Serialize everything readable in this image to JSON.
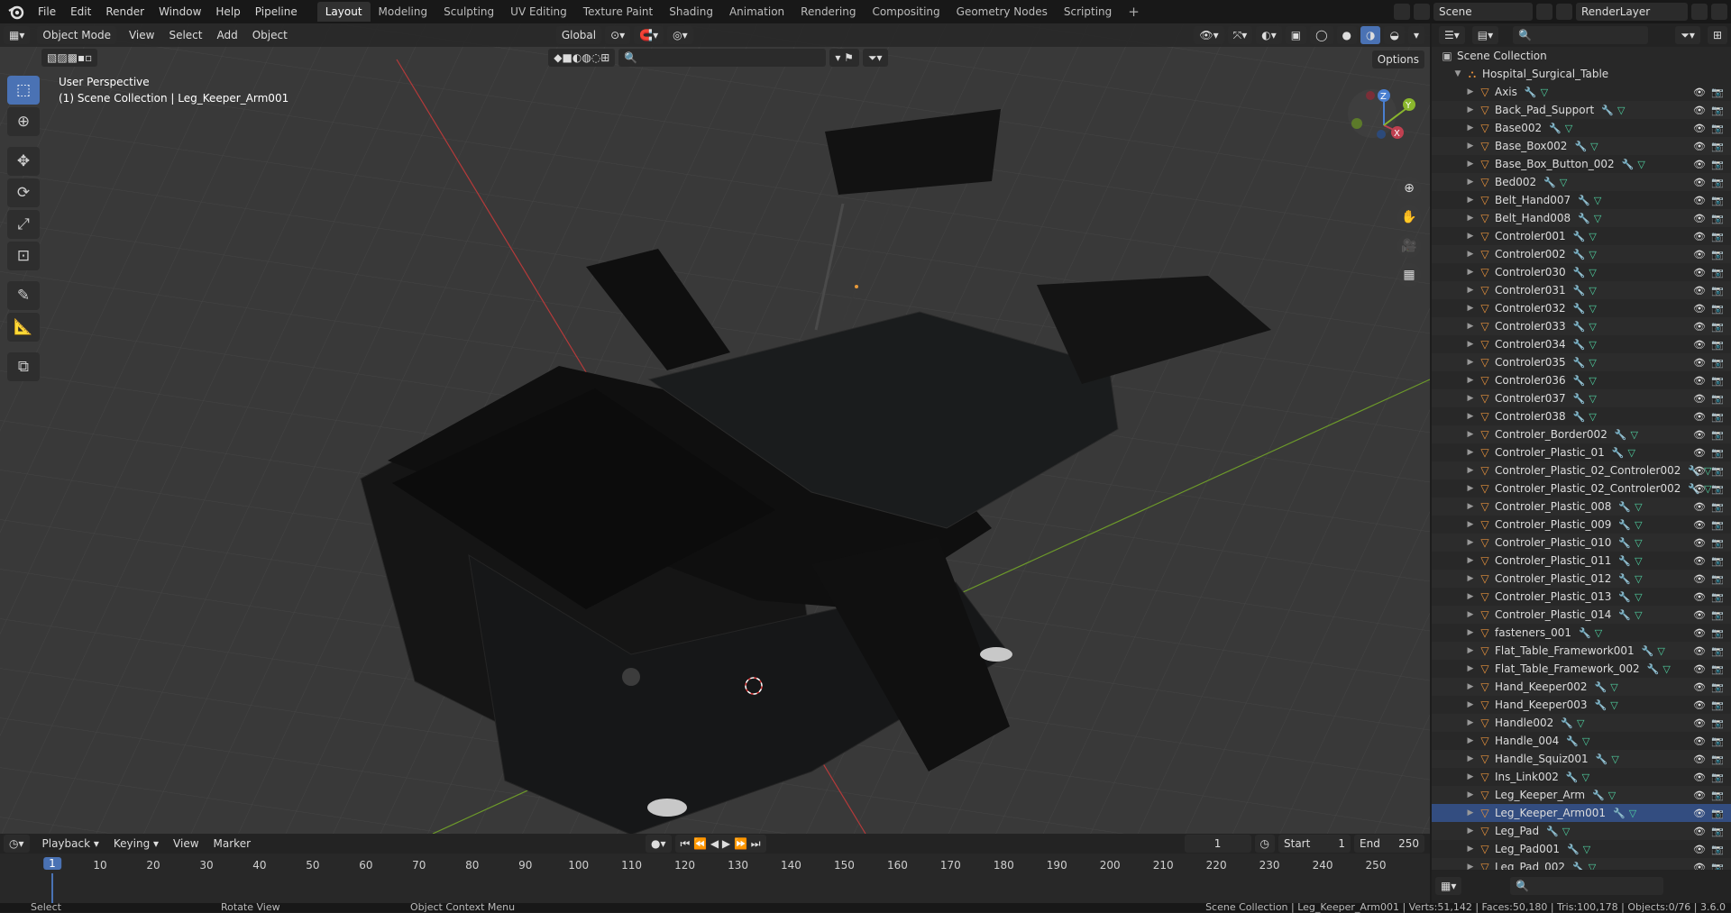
{
  "menu": [
    "File",
    "Edit",
    "Render",
    "Window",
    "Help",
    "Pipeline"
  ],
  "workspaces": [
    {
      "label": "Layout",
      "active": true
    },
    {
      "label": "Modeling"
    },
    {
      "label": "Sculpting"
    },
    {
      "label": "UV Editing"
    },
    {
      "label": "Texture Paint"
    },
    {
      "label": "Shading"
    },
    {
      "label": "Animation"
    },
    {
      "label": "Rendering"
    },
    {
      "label": "Compositing"
    },
    {
      "label": "Geometry Nodes"
    },
    {
      "label": "Scripting"
    }
  ],
  "scene": {
    "name": "Scene",
    "render_layer": "RenderLayer"
  },
  "viewport": {
    "mode": "Object Mode",
    "menus": [
      "View",
      "Select",
      "Add",
      "Object"
    ],
    "transform": "Global",
    "options": "Options",
    "title": "User Perspective",
    "subtitle": "(1) Scene Collection | Leg_Keeper_Arm001",
    "gizmo": {
      "x": "X",
      "y": "Y",
      "z": "Z"
    }
  },
  "outliner": {
    "root": "Scene Collection",
    "collection": "Hospital_Surgical_Table",
    "selected": "Leg_Keeper_Arm001",
    "items": [
      "Axis",
      "Back_Pad_Support",
      "Base002",
      "Base_Box002",
      "Base_Box_Button_002",
      "Bed002",
      "Belt_Hand007",
      "Belt_Hand008",
      "Controler001",
      "Controler002",
      "Controler030",
      "Controler031",
      "Controler032",
      "Controler033",
      "Controler034",
      "Controler035",
      "Controler036",
      "Controler037",
      "Controler038",
      "Controler_Border002",
      "Controler_Plastic_01",
      "Controler_Plastic_02_Controler002",
      "Controler_Plastic_02_Controler002",
      "Controler_Plastic_008",
      "Controler_Plastic_009",
      "Controler_Plastic_010",
      "Controler_Plastic_011",
      "Controler_Plastic_012",
      "Controler_Plastic_013",
      "Controler_Plastic_014",
      "fasteners_001",
      "Flat_Table_Framework001",
      "Flat_Table_Framework_002",
      "Hand_Keeper002",
      "Hand_Keeper003",
      "Handle002",
      "Handle_004",
      "Handle_Squiz001",
      "Ins_Link002",
      "Leg_Keeper_Arm",
      "Leg_Keeper_Arm001",
      "Leg_Pad",
      "Leg_Pad001",
      "Leg_Pad_002"
    ]
  },
  "timeline": {
    "menus": [
      "Playback",
      "Keying",
      "View",
      "Marker"
    ],
    "current": "1",
    "start_label": "Start",
    "start": "1",
    "end_label": "End",
    "end": "250",
    "ticks": [
      "1",
      "10",
      "20",
      "30",
      "40",
      "50",
      "60",
      "70",
      "80",
      "90",
      "100",
      "110",
      "120",
      "130",
      "140",
      "150",
      "160",
      "170",
      "180",
      "190",
      "200",
      "210",
      "220",
      "230",
      "240",
      "250"
    ]
  },
  "status": {
    "select": "Select",
    "rotate": "Rotate View",
    "context": "Object Context Menu",
    "info": "Scene Collection | Leg_Keeper_Arm001 | Verts:51,142 | Faces:50,180 | Tris:100,178 | Objects:0/76 | 3.6.0"
  }
}
